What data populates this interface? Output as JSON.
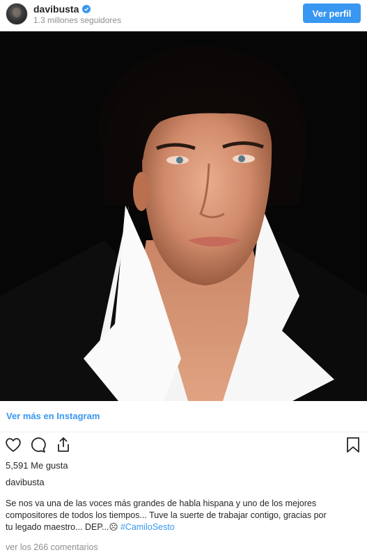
{
  "header": {
    "username": "davibusta",
    "followers": "1.3 millones seguidores",
    "view_profile_label": "Ver perfil"
  },
  "post": {
    "image_alt": "Retrato en primer plano de un hombre con cabello oscuro y camisa blanca de cuello ancho",
    "view_more_label": "Ver más en Instagram",
    "likes": "5,591 Me gusta",
    "author": "davibusta",
    "caption_line1": "Se nos va una de las voces más grandes de habla hispana y uno de los mejores",
    "caption_line2": "compositores de todos los tiempos... Tuve la suerte de trabajar contigo, gracias por",
    "caption_line3": "tu legado maestro... DEP...☹ ",
    "hashtag": "#CamiloSesto",
    "comments_link": "ver los 266 comentarios"
  },
  "icons": {
    "verified": "verified-badge-icon",
    "like": "heart-icon",
    "comment": "comment-icon",
    "share": "share-icon",
    "save": "bookmark-icon"
  },
  "colors": {
    "accent": "#3897f0",
    "text": "#262626",
    "muted": "#8e8e8e"
  }
}
